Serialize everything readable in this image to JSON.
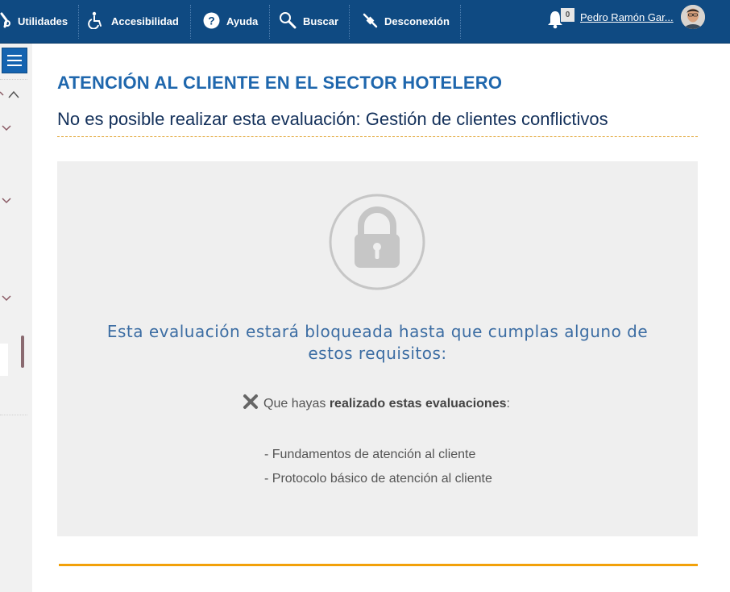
{
  "topbar": {
    "items": [
      {
        "label": "Utilidades",
        "icon": "tools-icon"
      },
      {
        "label": "Accesibilidad",
        "icon": "wheelchair-icon"
      },
      {
        "label": "Ayuda",
        "icon": "help-icon"
      },
      {
        "label": "Buscar",
        "icon": "search-icon"
      },
      {
        "label": "Desconexión",
        "icon": "disconnect-icon"
      }
    ],
    "notifications_count": "0",
    "username": "Pedro Ramón Gar..."
  },
  "main": {
    "course_title": "ATENCIÓN AL CLIENTE EN EL SECTOR HOTELERO",
    "evaluation_title": "No es posible realizar esta evaluación: Gestión de clientes conflictivos",
    "blocked_message": "Esta evaluación estará bloqueada hasta que cumplas alguno de estos requisitos:",
    "requirement": {
      "prefix": "Que hayas ",
      "bold": "realizado estas evaluaciones",
      "suffix": ":"
    },
    "required_evaluations": [
      "- Fundamentos de atención al cliente",
      "- Protocolo básico de atención al cliente"
    ]
  },
  "colors": {
    "topbar": "#0f4a82",
    "accent_title": "#1f67ad",
    "orange_rule": "#f2a10a",
    "panel_bg": "#efefef"
  }
}
